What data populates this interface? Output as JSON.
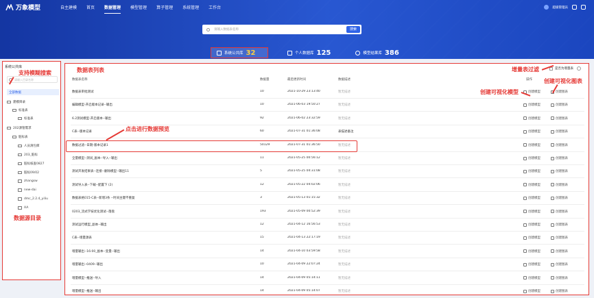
{
  "app": {
    "logo": "万象模型"
  },
  "nav": {
    "items": [
      "自主建模",
      "首页",
      "数据管理",
      "模型管理",
      "算子管理",
      "系统管理",
      "工作台"
    ],
    "user": "超级管理员"
  },
  "search": {
    "placeholder": "请输入数据表名称",
    "button": "搜索"
  },
  "tabs": [
    {
      "label": "系统公共库",
      "count": "32"
    },
    {
      "label": "个人数据库",
      "count": "125"
    },
    {
      "label": "模型结果库",
      "count": "386"
    }
  ],
  "sidebar": {
    "title": "系统公共库",
    "search_placeholder": "请输入目录名称",
    "all_label": "全部数据",
    "nodes": [
      "建模目录",
      "标准表",
      "标准表",
      "202源管需求",
      "脏标表",
      "人员清包库",
      "203_脏标",
      "脏标核查0827",
      "脏标09/02",
      "zhangsw",
      "new-dai",
      "dmc_2.2.4_yiliu",
      "AA"
    ]
  },
  "annotations": {
    "fuzzy": "支持模糊搜索",
    "list": "数据表列表",
    "filter": "增量表过滤",
    "create_chart": "创建可视化图表",
    "create_model": "创建可视化模型",
    "preview": "点击进行数据预览",
    "tree": "数据源目录"
  },
  "table": {
    "filter_label": "是否为增量表",
    "headers": [
      "数据表名称",
      "数据量",
      "最后更新时间",
      "数据描述",
      "操作"
    ],
    "action_model": "创建模型",
    "action_chart": "创建图表",
    "rows": [
      {
        "name": "数据表审批测试",
        "count": "10",
        "time": "2021-10-29 23:13:40",
        "desc": "暂无描述"
      },
      {
        "name": "编辑模型-开启版本记录--输出",
        "count": "10",
        "time": "2021-06-03 19:50:27",
        "desc": "暂无描述"
      },
      {
        "name": "6.2测试模型-开启版本--输出",
        "count": "92",
        "time": "2021-06-02 23:32:59",
        "desc": "暂无描述"
      },
      {
        "name": "C表--版本记录",
        "count": "60",
        "time": "2021-07-31 01:36:08",
        "desc": "表描述备注"
      },
      {
        "name": "数据过滤--日期-版本记录1",
        "count": "50129",
        "time": "2021-07-31 01:36:50",
        "desc": "暂无描述"
      },
      {
        "name": "全量模型--测试_副本--导入--输出",
        "count": "11",
        "time": "2021-05-25 00:56:12",
        "desc": "暂无描述"
      },
      {
        "name": "测试开发结果表--连接--删除模型--输出11",
        "count": "5",
        "time": "2021-05-25 04:31:08",
        "desc": "暂无描述"
      },
      {
        "name": "测试导入表--下载--配置下 (2)",
        "count": "12",
        "time": "2021-05-22 04:02:06",
        "desc": "暂无描述"
      },
      {
        "name": "数据表格015-C表--新增3条 --时间主键不重复",
        "count": "3",
        "time": "2021-05-13 01:15:32",
        "desc": "暂无描述"
      },
      {
        "name": "0203_流式学技优化测试--落盘",
        "count": "193",
        "time": "2021-05-09 00:52:39",
        "desc": "暂无描述"
      },
      {
        "name": "测试运行模型_副本--输出",
        "count": "12",
        "time": "2021-04-12 16:56:53",
        "desc": "暂无描述"
      },
      {
        "name": "C表--增量源表",
        "count": "15",
        "time": "2021-04-13 22:17:19",
        "desc": "暂无描述"
      },
      {
        "name": "增量输出--16:00_副本--变量--输出",
        "count": "14",
        "time": "2021-04-10 03:59:58",
        "desc": "暂无描述"
      },
      {
        "name": "增量输出--0409--输出",
        "count": "10",
        "time": "2021-04-09 22:07:24",
        "desc": "暂无描述"
      },
      {
        "name": "增量模型--推送--导入",
        "count": "14",
        "time": "2021-04-09 05:14:11",
        "desc": "暂无描述"
      },
      {
        "name": "增量模型--推送--输出",
        "count": "14",
        "time": "2021-04-09 05:14:07",
        "desc": "暂无描述"
      }
    ]
  }
}
